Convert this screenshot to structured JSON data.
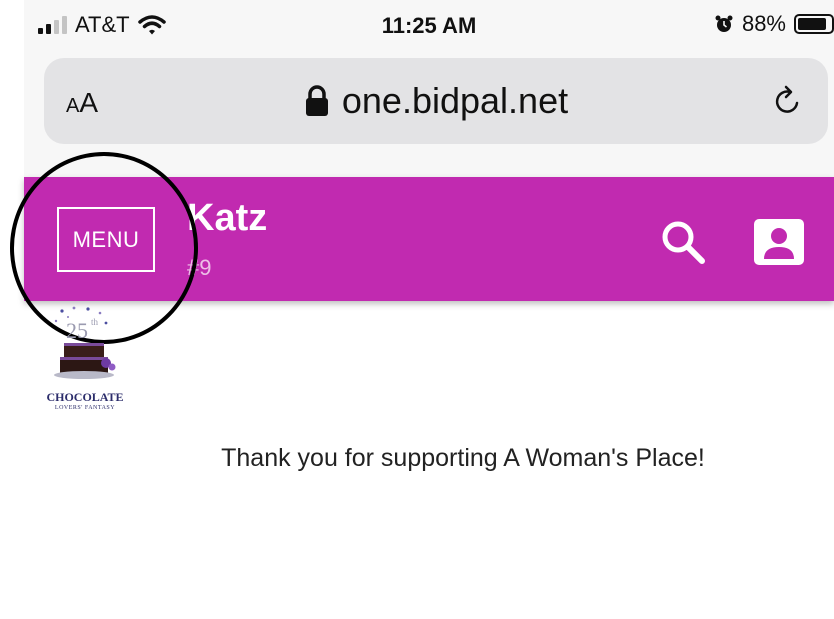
{
  "status_bar": {
    "carrier": "AT&T",
    "time": "11:25 AM",
    "battery": "88%",
    "battery_level": 0.88
  },
  "browser": {
    "text_size_small": "A",
    "text_size_big": "A",
    "url": "one.bidpal.net"
  },
  "header": {
    "menu_label": "MENU",
    "title": "Katz",
    "subtitle": "#9",
    "background_color": "#c12ab0"
  },
  "logo": {
    "number": "25",
    "suffix": "th",
    "name": "CHOCOLATE",
    "tagline": "LOVERS' FANTASY"
  },
  "content": {
    "message": "Thank you for supporting A Woman's Place!"
  },
  "icons": [
    "signal-icon",
    "wifi-icon",
    "alarm-icon",
    "battery-icon",
    "lock-icon",
    "reload-icon",
    "search-icon",
    "profile-icon"
  ]
}
